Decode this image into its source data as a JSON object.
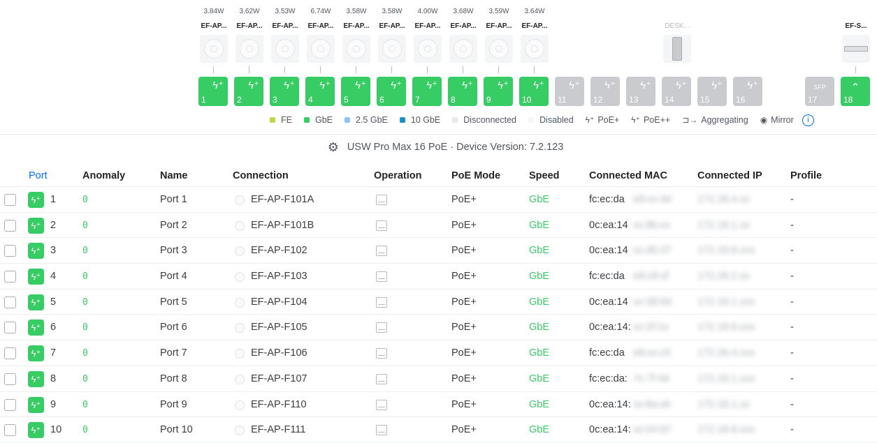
{
  "colors": {
    "green": "#38cc65",
    "grey_tile": "#c9cbce",
    "blue": "#006fff",
    "fe": "#b8d94a",
    "gbe": "#38cc65",
    "g25": "#92c3f5",
    "g10": "#1f8fbf",
    "disconnected": "#e8e9ea",
    "disabled": "#f5f5f6"
  },
  "ports_panel": {
    "ports": [
      {
        "num": "1",
        "watt": "3.84W",
        "device": "EF-AP...",
        "icon": "ap-icon",
        "state": "on",
        "kind": "poe"
      },
      {
        "num": "2",
        "watt": "3.62W",
        "device": "EF-AP...",
        "icon": "ap-icon",
        "state": "on",
        "kind": "poe"
      },
      {
        "num": "3",
        "watt": "3.53W",
        "device": "EF-AP...",
        "icon": "ap-icon",
        "state": "on",
        "kind": "poe"
      },
      {
        "num": "4",
        "watt": "6.74W",
        "device": "EF-AP...",
        "icon": "ap-icon",
        "state": "on",
        "kind": "poe"
      },
      {
        "num": "5",
        "watt": "3.58W",
        "device": "EF-AP...",
        "icon": "ap-icon",
        "state": "on",
        "kind": "poe"
      },
      {
        "num": "6",
        "watt": "3.58W",
        "device": "EF-AP...",
        "icon": "ap-icon",
        "state": "on",
        "kind": "poe"
      },
      {
        "num": "7",
        "watt": "4.00W",
        "device": "EF-AP...",
        "icon": "ap-icon",
        "state": "on",
        "kind": "poe"
      },
      {
        "num": "8",
        "watt": "3.68W",
        "device": "EF-AP...",
        "icon": "ap-icon",
        "state": "on",
        "kind": "poe"
      },
      {
        "num": "9",
        "watt": "3.59W",
        "device": "EF-AP...",
        "icon": "ap-icon",
        "state": "on",
        "kind": "poe"
      },
      {
        "num": "10",
        "watt": "3.64W",
        "device": "EF-AP...",
        "icon": "ap-icon",
        "state": "on",
        "kind": "poe"
      },
      {
        "num": "11",
        "watt": "",
        "device": "",
        "icon": "",
        "state": "off",
        "kind": "poe"
      },
      {
        "num": "12",
        "watt": "",
        "device": "",
        "icon": "",
        "state": "off",
        "kind": "poe"
      },
      {
        "num": "13",
        "watt": "",
        "device": "",
        "icon": "",
        "state": "off",
        "kind": "poepp"
      },
      {
        "num": "14",
        "watt": "",
        "device": "DESK...",
        "icon": "desktop-icon",
        "state": "off",
        "kind": "poepp"
      },
      {
        "num": "15",
        "watt": "",
        "device": "",
        "icon": "",
        "state": "off",
        "kind": "poepp"
      },
      {
        "num": "16",
        "watt": "",
        "device": "",
        "icon": "",
        "state": "off",
        "kind": "poepp"
      },
      {
        "num": "17",
        "watt": "",
        "device": "",
        "icon": "",
        "state": "off",
        "kind": "sfp",
        "label": "SFP"
      },
      {
        "num": "18",
        "watt": "",
        "device": "EF-S...",
        "icon": "switch-icon",
        "state": "on",
        "kind": "uplink"
      }
    ]
  },
  "legend": {
    "fe": "FE",
    "gbe": "GbE",
    "g25": "2.5 GbE",
    "g10": "10 GbE",
    "disconnected": "Disconnected",
    "disabled": "Disabled",
    "poe": "PoE+",
    "poepp": "PoE++",
    "aggregating": "Aggregating",
    "mirror": "Mirror"
  },
  "device_line": "USW Pro Max 16 PoE · Device Version: 7.2.123",
  "table": {
    "headers": {
      "port": "Port",
      "anomaly": "Anomaly",
      "name": "Name",
      "connection": "Connection",
      "operation": "Operation",
      "poe_mode": "PoE Mode",
      "speed": "Speed",
      "mac": "Connected MAC",
      "ip": "Connected IP",
      "profile": "Profile"
    },
    "rows": [
      {
        "port": "1",
        "anomaly": "0",
        "name": "Port 1",
        "connection": "EF-AP-F101A",
        "poe": "PoE+",
        "speed": "GbE",
        "mac": "fc:ec:da",
        "mac_hidden": "e8:xx:4d",
        "ip_hidden": "172.28.4.xx",
        "profile": "-"
      },
      {
        "port": "2",
        "anomaly": "0",
        "name": "Port 2",
        "connection": "EF-AP-F101B",
        "poe": "PoE+",
        "speed": "GbE",
        "mac": "0c:ea:14",
        "mac_hidden": "xx:8b:xx",
        "ip_hidden": "172.18.1.xx",
        "profile": "-"
      },
      {
        "port": "3",
        "anomaly": "0",
        "name": "Port 3",
        "connection": "EF-AP-F102",
        "poe": "PoE+",
        "speed": "GbE",
        "mac": "0c:ea:14",
        "mac_hidden": "xx:d0:37",
        "ip_hidden": "172.18.8.xxx",
        "profile": "-"
      },
      {
        "port": "4",
        "anomaly": "0",
        "name": "Port 4",
        "connection": "EF-AP-F103",
        "poe": "PoE+",
        "speed": "GbE",
        "mac": "fc:ec:da",
        "mac_hidden": "e8:c8:xf",
        "ip_hidden": "172.28.2.xx",
        "profile": "-"
      },
      {
        "port": "5",
        "anomaly": "0",
        "name": "Port 5",
        "connection": "EF-AP-F104",
        "poe": "PoE+",
        "speed": "GbE",
        "mac": "0c:ea:14",
        "mac_hidden": "xx:38:9d",
        "ip_hidden": "172.18.1.xxx",
        "profile": "-"
      },
      {
        "port": "6",
        "anomaly": "0",
        "name": "Port 6",
        "connection": "EF-AP-F105",
        "poe": "PoE+",
        "speed": "GbE",
        "mac": "0c:ea:14:",
        "mac_hidden": "xx:2f:1e",
        "ip_hidden": "172.18.8.xxx",
        "profile": "-"
      },
      {
        "port": "7",
        "anomaly": "0",
        "name": "Port 7",
        "connection": "EF-AP-F106",
        "poe": "PoE+",
        "speed": "GbE",
        "mac": "fc:ec:da",
        "mac_hidden": "e8:xx:c5",
        "ip_hidden": "172.28.4.xxx",
        "profile": "-"
      },
      {
        "port": "8",
        "anomaly": "0",
        "name": "Port 8",
        "connection": "EF-AP-F107",
        "poe": "PoE+",
        "speed": "GbE",
        "mac": "fc:ec:da:",
        "mac_hidden": "7c:7f:4d",
        "ip_hidden": "172.18.1.xxx",
        "profile": "-"
      },
      {
        "port": "9",
        "anomaly": "0",
        "name": "Port 9",
        "connection": "EF-AP-F110",
        "poe": "PoE+",
        "speed": "GbE",
        "mac": "0c:ea:14:",
        "mac_hidden": "xx:8a:xb",
        "ip_hidden": "172.18.1.xx",
        "profile": "-"
      },
      {
        "port": "10",
        "anomaly": "0",
        "name": "Port 10",
        "connection": "EF-AP-F111",
        "poe": "PoE+",
        "speed": "GbE",
        "mac": "0c:ea:14:",
        "mac_hidden": "xx:04:87",
        "ip_hidden": "172.18.8.xxx",
        "profile": "-"
      }
    ]
  }
}
